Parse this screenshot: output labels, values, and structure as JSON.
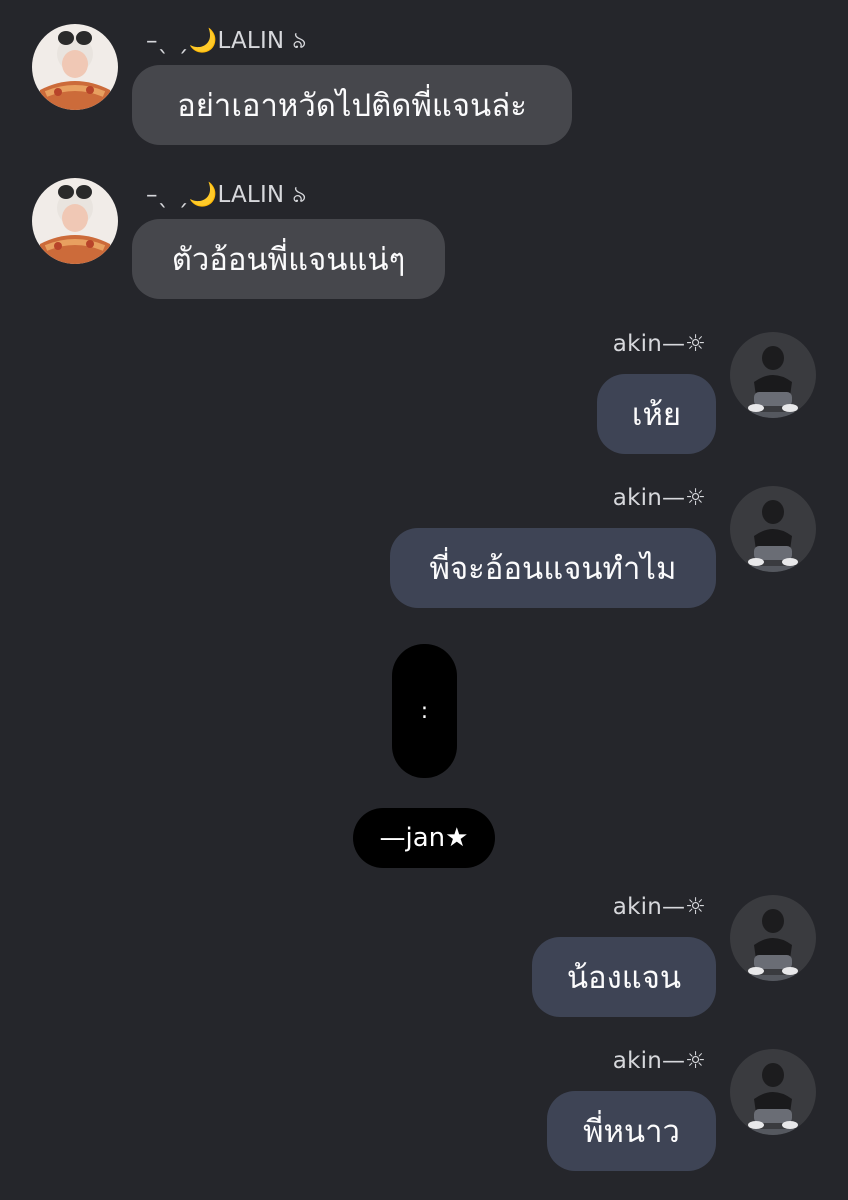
{
  "colors": {
    "background": "#25262b",
    "incoming_bubble": "#46474c",
    "outgoing_bubble": "#3e4455",
    "text": "#fbfbfc",
    "divider_pill": "#000000"
  },
  "messages": [
    {
      "side": "incoming",
      "sender": "–ˎ ˏ🌙LALIN ৯",
      "text": "อย่าเอาหวัดไปติดพี่แจนล่ะ"
    },
    {
      "side": "incoming",
      "sender": "–ˎ ˏ🌙LALIN ৯",
      "text": "ตัวอ้อนพี่แจนแน่ๆ"
    },
    {
      "side": "outgoing",
      "sender": "akin—☼",
      "text": "เห้ย"
    },
    {
      "side": "outgoing",
      "sender": "akin—☼",
      "text": "พี่จะอ้อนแจนทำไม"
    },
    {
      "side": "outgoing",
      "sender": "akin—☼",
      "text": "น้องแจน"
    },
    {
      "side": "outgoing",
      "sender": "akin—☼",
      "text": "พี่หนาว"
    }
  ],
  "divider": {
    "dots": ":",
    "tag": "—jan★"
  }
}
